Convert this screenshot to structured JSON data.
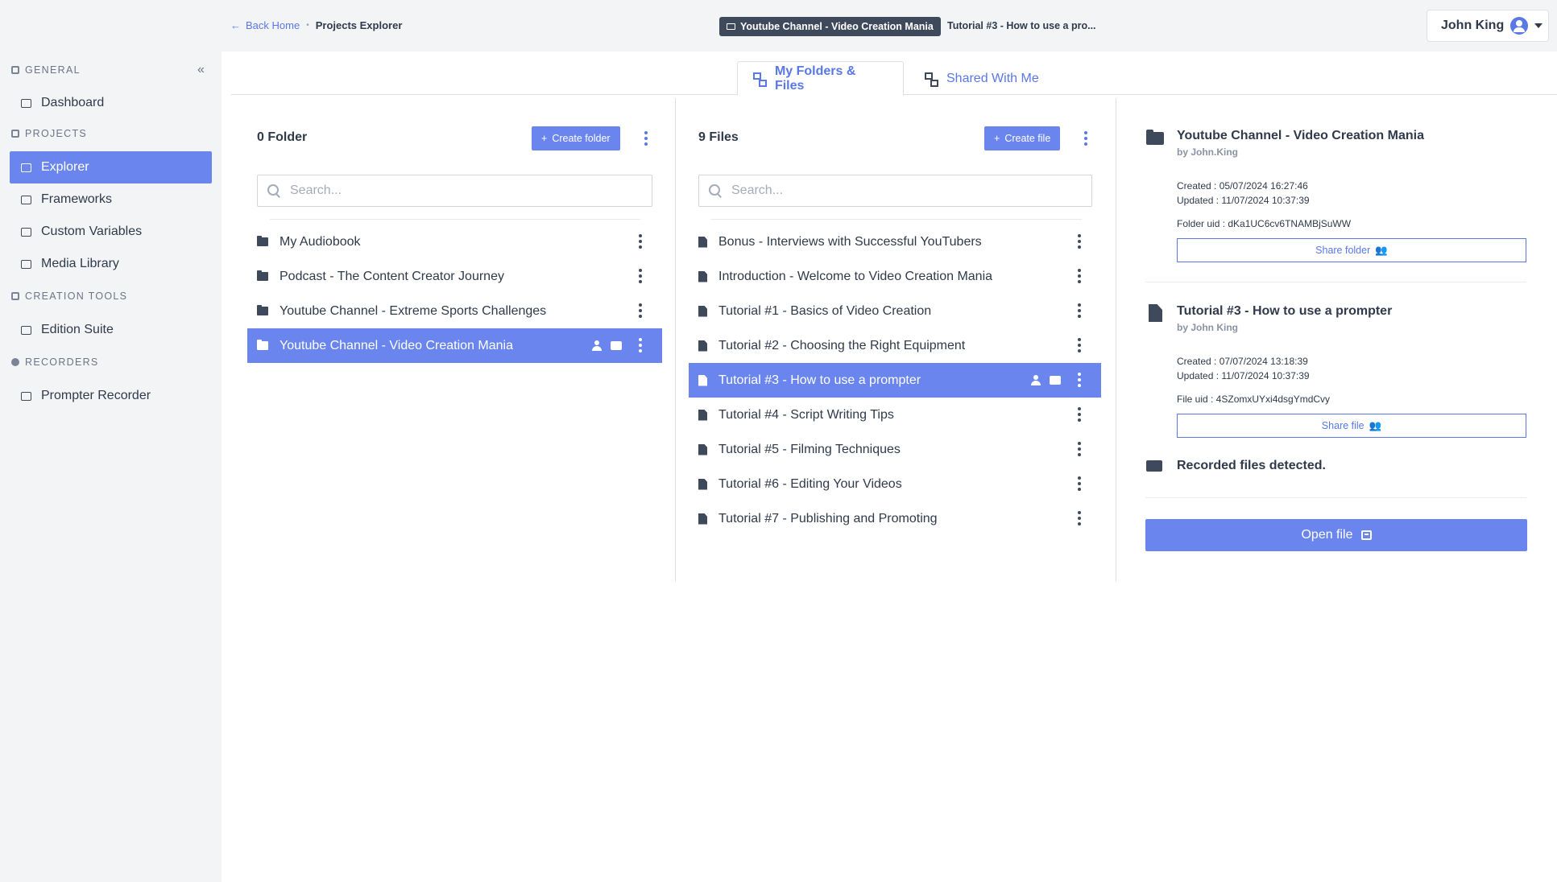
{
  "header": {
    "back_label": "Back Home",
    "current_page": "Projects Explorer",
    "folder_chip": "Youtube Channel - Video Creation Mania",
    "file_chip": "Tutorial #3 - How to use a pro...",
    "user_name": "John King"
  },
  "sidebar": {
    "sections": {
      "general": "GENERAL",
      "projects": "PROJECTS",
      "creation_tools": "CREATION TOOLS",
      "recorders": "RECORDERS"
    },
    "items": [
      {
        "label": "Dashboard",
        "icon": "dashboard-icon"
      },
      {
        "label": "Explorer",
        "icon": "explorer-icon",
        "active": true
      },
      {
        "label": "Frameworks",
        "icon": "frameworks-icon"
      },
      {
        "label": "Custom Variables",
        "icon": "variables-icon"
      },
      {
        "label": "Media Library",
        "icon": "media-icon"
      },
      {
        "label": "Edition Suite",
        "icon": "edition-icon"
      },
      {
        "label": "Prompter Recorder",
        "icon": "prompter-icon"
      }
    ]
  },
  "tabs": [
    {
      "label": "My Folders & Files",
      "active": true
    },
    {
      "label": "Shared With Me",
      "active": false
    }
  ],
  "folders_col": {
    "title": "0 Folder",
    "create_label": "Create folder",
    "search_placeholder": "Search...",
    "items": [
      {
        "label": "My Audiobook"
      },
      {
        "label": "Podcast - The Content Creator Journey"
      },
      {
        "label": "Youtube Channel - Extreme Sports Challenges"
      },
      {
        "label": "Youtube Channel - Video Creation Mania",
        "selected": true
      }
    ]
  },
  "files_col": {
    "title": "9 Files",
    "create_label": "Create file",
    "search_placeholder": "Search...",
    "items": [
      {
        "label": "Bonus - Interviews with Successful YouTubers"
      },
      {
        "label": "Introduction - Welcome to Video Creation Mania"
      },
      {
        "label": "Tutorial #1 - Basics of Video Creation"
      },
      {
        "label": "Tutorial #2 - Choosing the Right Equipment"
      },
      {
        "label": "Tutorial #3 - How to use a prompter",
        "selected": true
      },
      {
        "label": "Tutorial #4 - Script Writing Tips"
      },
      {
        "label": "Tutorial #5 - Filming Techniques"
      },
      {
        "label": "Tutorial #6 - Editing Your Videos"
      },
      {
        "label": "Tutorial #7 - Publishing and Promoting"
      }
    ]
  },
  "details": {
    "folder": {
      "title": "Youtube Channel - Video Creation Mania",
      "by": "by John.King",
      "created": "Created : 05/07/2024 16:27:46",
      "updated": "Updated : 11/07/2024 10:37:39",
      "uid": "Folder uid : dKa1UC6cv6TNAMBjSuWW",
      "share_label": "Share folder"
    },
    "file": {
      "title": "Tutorial #3 - How to use a prompter",
      "by": "by John King",
      "created": "Created : 07/07/2024 13:18:39",
      "updated": "Updated : 11/07/2024 10:37:39",
      "uid": "File uid : 4SZomxUYxi4dsgYmdCvy",
      "share_label": "Share file"
    },
    "recorded_notice": "Recorded files detected.",
    "open_label": "Open file"
  },
  "colors": {
    "accent": "#6a86ee",
    "accent_text": "#5a78e6",
    "sidebar_bg": "#f3f4f6",
    "dark_text": "#2f3a4a"
  }
}
